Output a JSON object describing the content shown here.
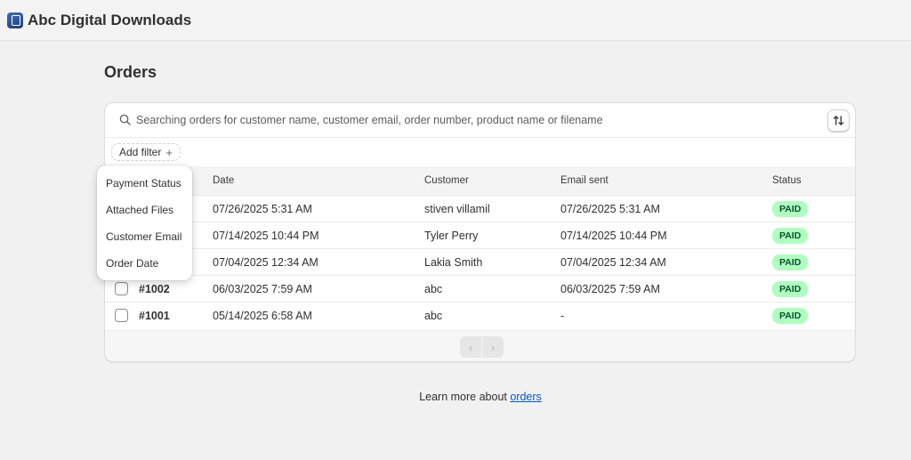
{
  "app": {
    "title": "Abc Digital Downloads"
  },
  "page": {
    "title": "Orders"
  },
  "search": {
    "placeholder": "Searching orders for customer name, customer email, order number, product name or filename"
  },
  "filters": {
    "add_label": "Add filter",
    "plus": "+"
  },
  "filter_menu": {
    "items": [
      "Payment Status",
      "Attached Files",
      "Customer Email",
      "Order Date"
    ]
  },
  "table": {
    "columns": {
      "date": "Date",
      "customer": "Customer",
      "email_sent": "Email sent",
      "status": "Status"
    },
    "rows": [
      {
        "order": "",
        "date": "07/26/2025 5:31 AM",
        "customer": "stiven villamil",
        "email_sent": "07/26/2025 5:31 AM",
        "status": "PAID"
      },
      {
        "order": "",
        "date": "07/14/2025 10:44 PM",
        "customer": "Tyler Perry",
        "email_sent": "07/14/2025 10:44 PM",
        "status": "PAID"
      },
      {
        "order": "",
        "date": "07/04/2025 12:34 AM",
        "customer": "Lakia Smith",
        "email_sent": "07/04/2025 12:34 AM",
        "status": "PAID"
      },
      {
        "order": "#1002",
        "date": "06/03/2025 7:59 AM",
        "customer": "abc",
        "email_sent": "06/03/2025 7:59 AM",
        "status": "PAID"
      },
      {
        "order": "#1001",
        "date": "05/14/2025 6:58 AM",
        "customer": "abc",
        "email_sent": "-",
        "status": "PAID"
      }
    ]
  },
  "pagination": {
    "prev": "‹",
    "next": "›"
  },
  "footer": {
    "text": "Learn more about ",
    "link": "orders"
  },
  "colors": {
    "paid_badge_bg": "#affebf",
    "paid_badge_text": "#0c5132",
    "link": "#005bd3"
  }
}
